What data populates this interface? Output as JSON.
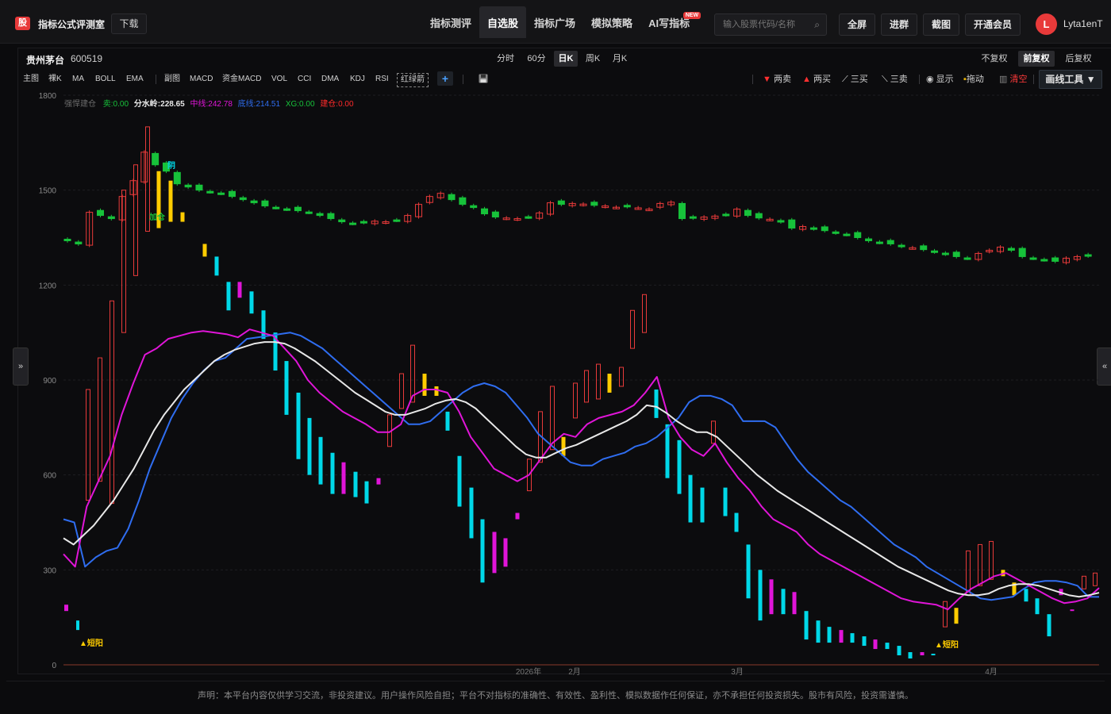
{
  "app": {
    "logo_char": "股",
    "title": "指标公式评测室",
    "download_label": "下载"
  },
  "nav": [
    {
      "label": "指标测评",
      "active": false,
      "badge": ""
    },
    {
      "label": "自选股",
      "active": true,
      "badge": ""
    },
    {
      "label": "指标广场",
      "active": false,
      "badge": ""
    },
    {
      "label": "模拟策略",
      "active": false,
      "badge": ""
    },
    {
      "label": "AI写指标",
      "active": false,
      "badge": "NEW"
    }
  ],
  "search": {
    "placeholder": "输入股票代码/名称",
    "icon": "search-icon"
  },
  "header_buttons": {
    "fullscreen": "全屏",
    "join_group": "进群",
    "screenshot": "截图",
    "membership": "开通会员"
  },
  "user": {
    "avatar_letter": "L",
    "name": "Lyta1enT"
  },
  "stock": {
    "name": "贵州茅台",
    "code": "600519"
  },
  "periods": [
    {
      "label": "分时",
      "active": false
    },
    {
      "label": "60分",
      "active": false
    },
    {
      "label": "日K",
      "active": true
    },
    {
      "label": "周K",
      "active": false
    },
    {
      "label": "月K",
      "active": false
    }
  ],
  "adjust": [
    {
      "label": "不复权",
      "active": false
    },
    {
      "label": "前复权",
      "active": true
    },
    {
      "label": "后复权",
      "active": false
    }
  ],
  "indicators": {
    "main": [
      "主图",
      "裸K",
      "MA",
      "BOLL",
      "EMA"
    ],
    "sub": [
      "副图",
      "MACD",
      "资金MACD",
      "VOL",
      "CCI",
      "DMA",
      "KDJ",
      "RSI"
    ],
    "custom": "红绿箭"
  },
  "right_tools": {
    "two_sell": "两卖",
    "two_buy": "两买",
    "three_buy": "三买",
    "three_sell": "三卖",
    "show": "显示",
    "drag": "拖动",
    "clear": "清空",
    "draw_tool": "画线工具 ▼"
  },
  "legend": {
    "prefix": "强悍建仓",
    "items": [
      {
        "label": "卖:0.00",
        "color": "#17c23a"
      },
      {
        "label": "分水岭:228.65",
        "color": "#e8e8e8"
      },
      {
        "label": "中线:242.78",
        "color": "#e015d8"
      },
      {
        "label": "底线:214.51",
        "color": "#2f6df0"
      },
      {
        "label": "XG:0.00",
        "color": "#17c23a"
      },
      {
        "label": "建仓:0.00",
        "color": "#ff2a2a"
      }
    ]
  },
  "chart_data": {
    "type": "candlestick-with-indicators",
    "ylim": [
      0,
      1800
    ],
    "yticks": [
      0,
      300,
      600,
      900,
      1200,
      1500,
      1800
    ],
    "xticks": [
      "2026年",
      "2月",
      "3月",
      "4月"
    ],
    "price_range_approx": [
      1250,
      1700
    ],
    "annotations": [
      "阴",
      "加仓",
      "短阳",
      "短阳"
    ],
    "lines": {
      "白线_分水岭": [
        400,
        380,
        410,
        440,
        480,
        520,
        570,
        620,
        680,
        740,
        790,
        830,
        870,
        900,
        930,
        960,
        980,
        995,
        1005,
        1015,
        1020,
        1020,
        1015,
        1000,
        980,
        960,
        935,
        910,
        885,
        860,
        840,
        820,
        800,
        790,
        790,
        800,
        810,
        825,
        835,
        840,
        830,
        810,
        780,
        750,
        720,
        690,
        665,
        655,
        655,
        670,
        685,
        695,
        710,
        725,
        740,
        755,
        770,
        790,
        820,
        815,
        795,
        770,
        750,
        735,
        735,
        720,
        690,
        660,
        630,
        600,
        575,
        550,
        530,
        510,
        490,
        470,
        450,
        430,
        410,
        390,
        370,
        350,
        330,
        310,
        295,
        280,
        265,
        250,
        235,
        225,
        220,
        220,
        225,
        240,
        250,
        255,
        255,
        250,
        240,
        230,
        220,
        215,
        220,
        228
      ],
      "紫线_中线": [
        350,
        310,
        500,
        580,
        660,
        790,
        890,
        980,
        1000,
        1030,
        1040,
        1050,
        1055,
        1050,
        1045,
        1035,
        1060,
        1050,
        1040,
        1000,
        960,
        900,
        860,
        830,
        800,
        780,
        760,
        735,
        735,
        760,
        850,
        870,
        870,
        860,
        800,
        720,
        670,
        620,
        600,
        580,
        600,
        650,
        700,
        730,
        720,
        760,
        780,
        790,
        800,
        820,
        860,
        910,
        780,
        720,
        680,
        660,
        700,
        640,
        590,
        550,
        500,
        460,
        440,
        420,
        380,
        350,
        330,
        310,
        290,
        270,
        250,
        230,
        210,
        200,
        195,
        190,
        175,
        210,
        240,
        260,
        280,
        290,
        270,
        250,
        230,
        210,
        195,
        200,
        210,
        243
      ],
      "蓝线_底线": [
        460,
        450,
        310,
        340,
        360,
        370,
        430,
        520,
        620,
        700,
        780,
        840,
        890,
        930,
        960,
        970,
        1000,
        1030,
        1035,
        1040,
        1045,
        1050,
        1040,
        1020,
        1000,
        970,
        940,
        910,
        880,
        850,
        820,
        790,
        760,
        760,
        770,
        800,
        830,
        860,
        880,
        890,
        880,
        860,
        820,
        780,
        730,
        700,
        670,
        640,
        630,
        630,
        650,
        660,
        670,
        690,
        700,
        720,
        750,
        780,
        830,
        850,
        850,
        840,
        820,
        770,
        770,
        770,
        750,
        700,
        650,
        610,
        580,
        550,
        520,
        500,
        470,
        440,
        410,
        380,
        360,
        340,
        310,
        290,
        270,
        250,
        230,
        210,
        205,
        210,
        215,
        240,
        260,
        265,
        265,
        260,
        250,
        215,
        214.51
      ]
    }
  },
  "footer": "声明：本平台内容仅供学习交流，非投资建议。用户操作风险自担；平台不对指标的准确性、有效性、盈利性、模拟数据作任何保证，亦不承担任何投资损失。股市有风险，投资需谨慎。"
}
